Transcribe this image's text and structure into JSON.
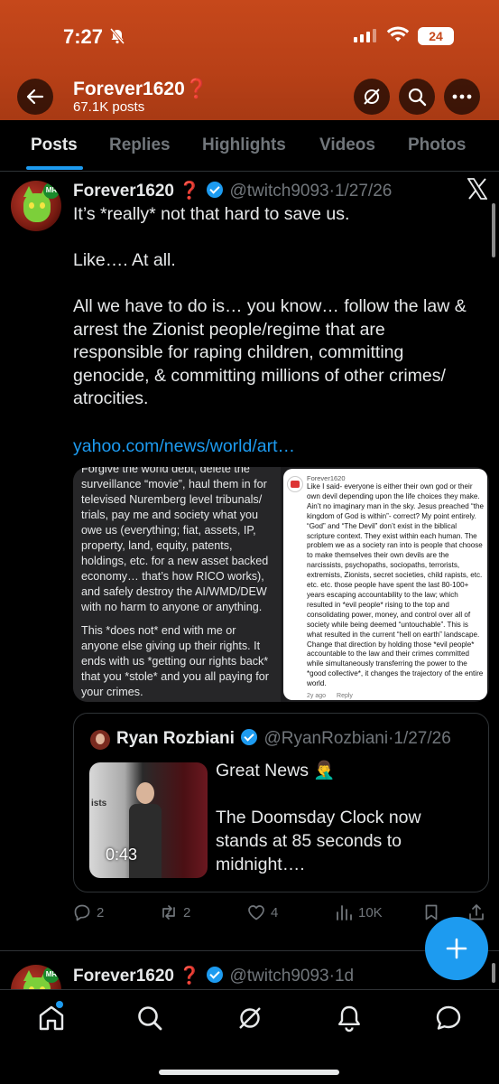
{
  "status_bar": {
    "time": "7:27",
    "battery": "24"
  },
  "header": {
    "name": "Forever1620",
    "name_suffix": "❓",
    "post_count": "67.1K posts"
  },
  "tabs": [
    {
      "label": "Posts",
      "active": true
    },
    {
      "label": "Replies"
    },
    {
      "label": "Highlights"
    },
    {
      "label": "Videos"
    },
    {
      "label": "Photos"
    }
  ],
  "post": {
    "author": "Forever1620",
    "author_suffix": "❓",
    "handle": "@twitch9093",
    "date": "1/27/26",
    "text": "It’s *really* not that hard to save us.\n\nLike…. At all.\n\nAll we have to do is… you know… follow the law & arrest the Zionist people/regime that are responsible for raping children, committing genocide, & committing millions of other crimes/ atrocities.",
    "link": "yahoo.com/news/world/art…",
    "media_left": {
      "paragraph_1": "Forgive the world debt, delete the surveillance “movie”, haul them in for televised Nuremberg level tribunals/ trials, pay me and society what you owe us (everything; fiat, assets, IP, property, land, equity, patents, holdings, etc. for a new asset backed economy… that’s how RICO works), and safely destroy the AI/WMD/DEW with no harm to anyone or anything.",
      "paragraph_2": "This *does not* end with me or anyone else giving up their rights. It ends with us *getting our rights back* that you *stole* and you all paying for your crimes."
    },
    "media_right": {
      "name": "Forever1620",
      "text": "Like I said- everyone is either their own god or their own devil depending upon the life choices they make. Ain’t no imaginary man in the sky. Jesus preached “the kingdom of God is within”- correct? My point entirely. “God” and “The Devil” don’t exist in the biblical scripture context. They exist within each human. The problem we as a society ran into is people that choose to make themselves their own devils are the narcissists, psychopaths, sociopaths, terrorists, extremists, Zionists, secret societies, child rapists, etc. etc. etc. those people have spent the last 80-100+ years escaping accountability to the law; which resulted in *evil people* rising to the top and consolidating power, money, and control over all of society while being deemed “untouchable”. This is what resulted in the current “hell on earth” landscape. Change that direction by holding those *evil people* accountable to the law and their crimes committed while simultaneously transferring the power to the *good collective*, it changes the trajectory of the entire world.",
      "time": "2y ago",
      "reply": "Reply"
    },
    "quote": {
      "author": "Ryan Rozbiani",
      "handle": "@RyanRozbiani",
      "date": "1/27/26",
      "text": "Great News 🤦‍♂️\n\nThe Doomsday Clock now stands at 85 seconds to midnight….",
      "video_duration": "0:43",
      "thumb_text": "ists"
    },
    "actions": {
      "replies": "2",
      "reposts": "2",
      "likes": "4",
      "views": "10K"
    }
  },
  "next_post": {
    "author": "Forever1620",
    "author_suffix": "❓",
    "handle": "@twitch9093",
    "date": "1d"
  },
  "colors": {
    "accent": "#1d9bf0",
    "banner": "#c6481b",
    "background": "#000000",
    "muted": "#71767b"
  },
  "icons": [
    "back-arrow-icon",
    "grok-icon",
    "search-icon",
    "more-icon",
    "x-logo-icon",
    "reply-icon",
    "repost-icon",
    "like-icon",
    "views-icon",
    "bookmark-icon",
    "share-icon",
    "compose-icon",
    "home-icon",
    "notifications-icon",
    "messages-icon"
  ]
}
